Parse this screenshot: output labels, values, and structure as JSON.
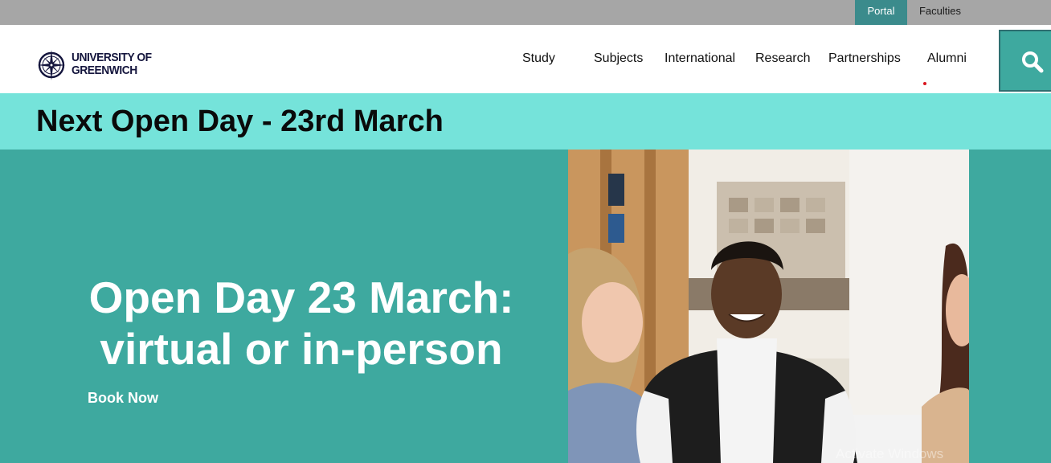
{
  "utility_nav": {
    "portal_label": "Portal",
    "faculties_label": "Faculties"
  },
  "logo": {
    "line1": "UNIVERSITY OF",
    "line2": "GREENWICH"
  },
  "main_nav": {
    "items": [
      {
        "label": "Study"
      },
      {
        "label": "Subjects"
      },
      {
        "label": "International"
      },
      {
        "label": "Research"
      },
      {
        "label": "Partnerships"
      },
      {
        "label": "Alumni"
      }
    ]
  },
  "search": {
    "icon": "search-icon"
  },
  "announcement": {
    "text": "Next Open Day - 23rd March"
  },
  "hero": {
    "title": "Open Day 23 March: virtual or in-person",
    "cta_label": "Book Now"
  },
  "os_watermark": "Activate Windows",
  "colors": {
    "utility_bar": "#a6a6a6",
    "portal_bg": "#3b8b8c",
    "brand_teal": "#3ea99f",
    "announcement_bg": "#75e3da",
    "logo_navy": "#14153d",
    "nav_indicator": "#d9161f"
  }
}
